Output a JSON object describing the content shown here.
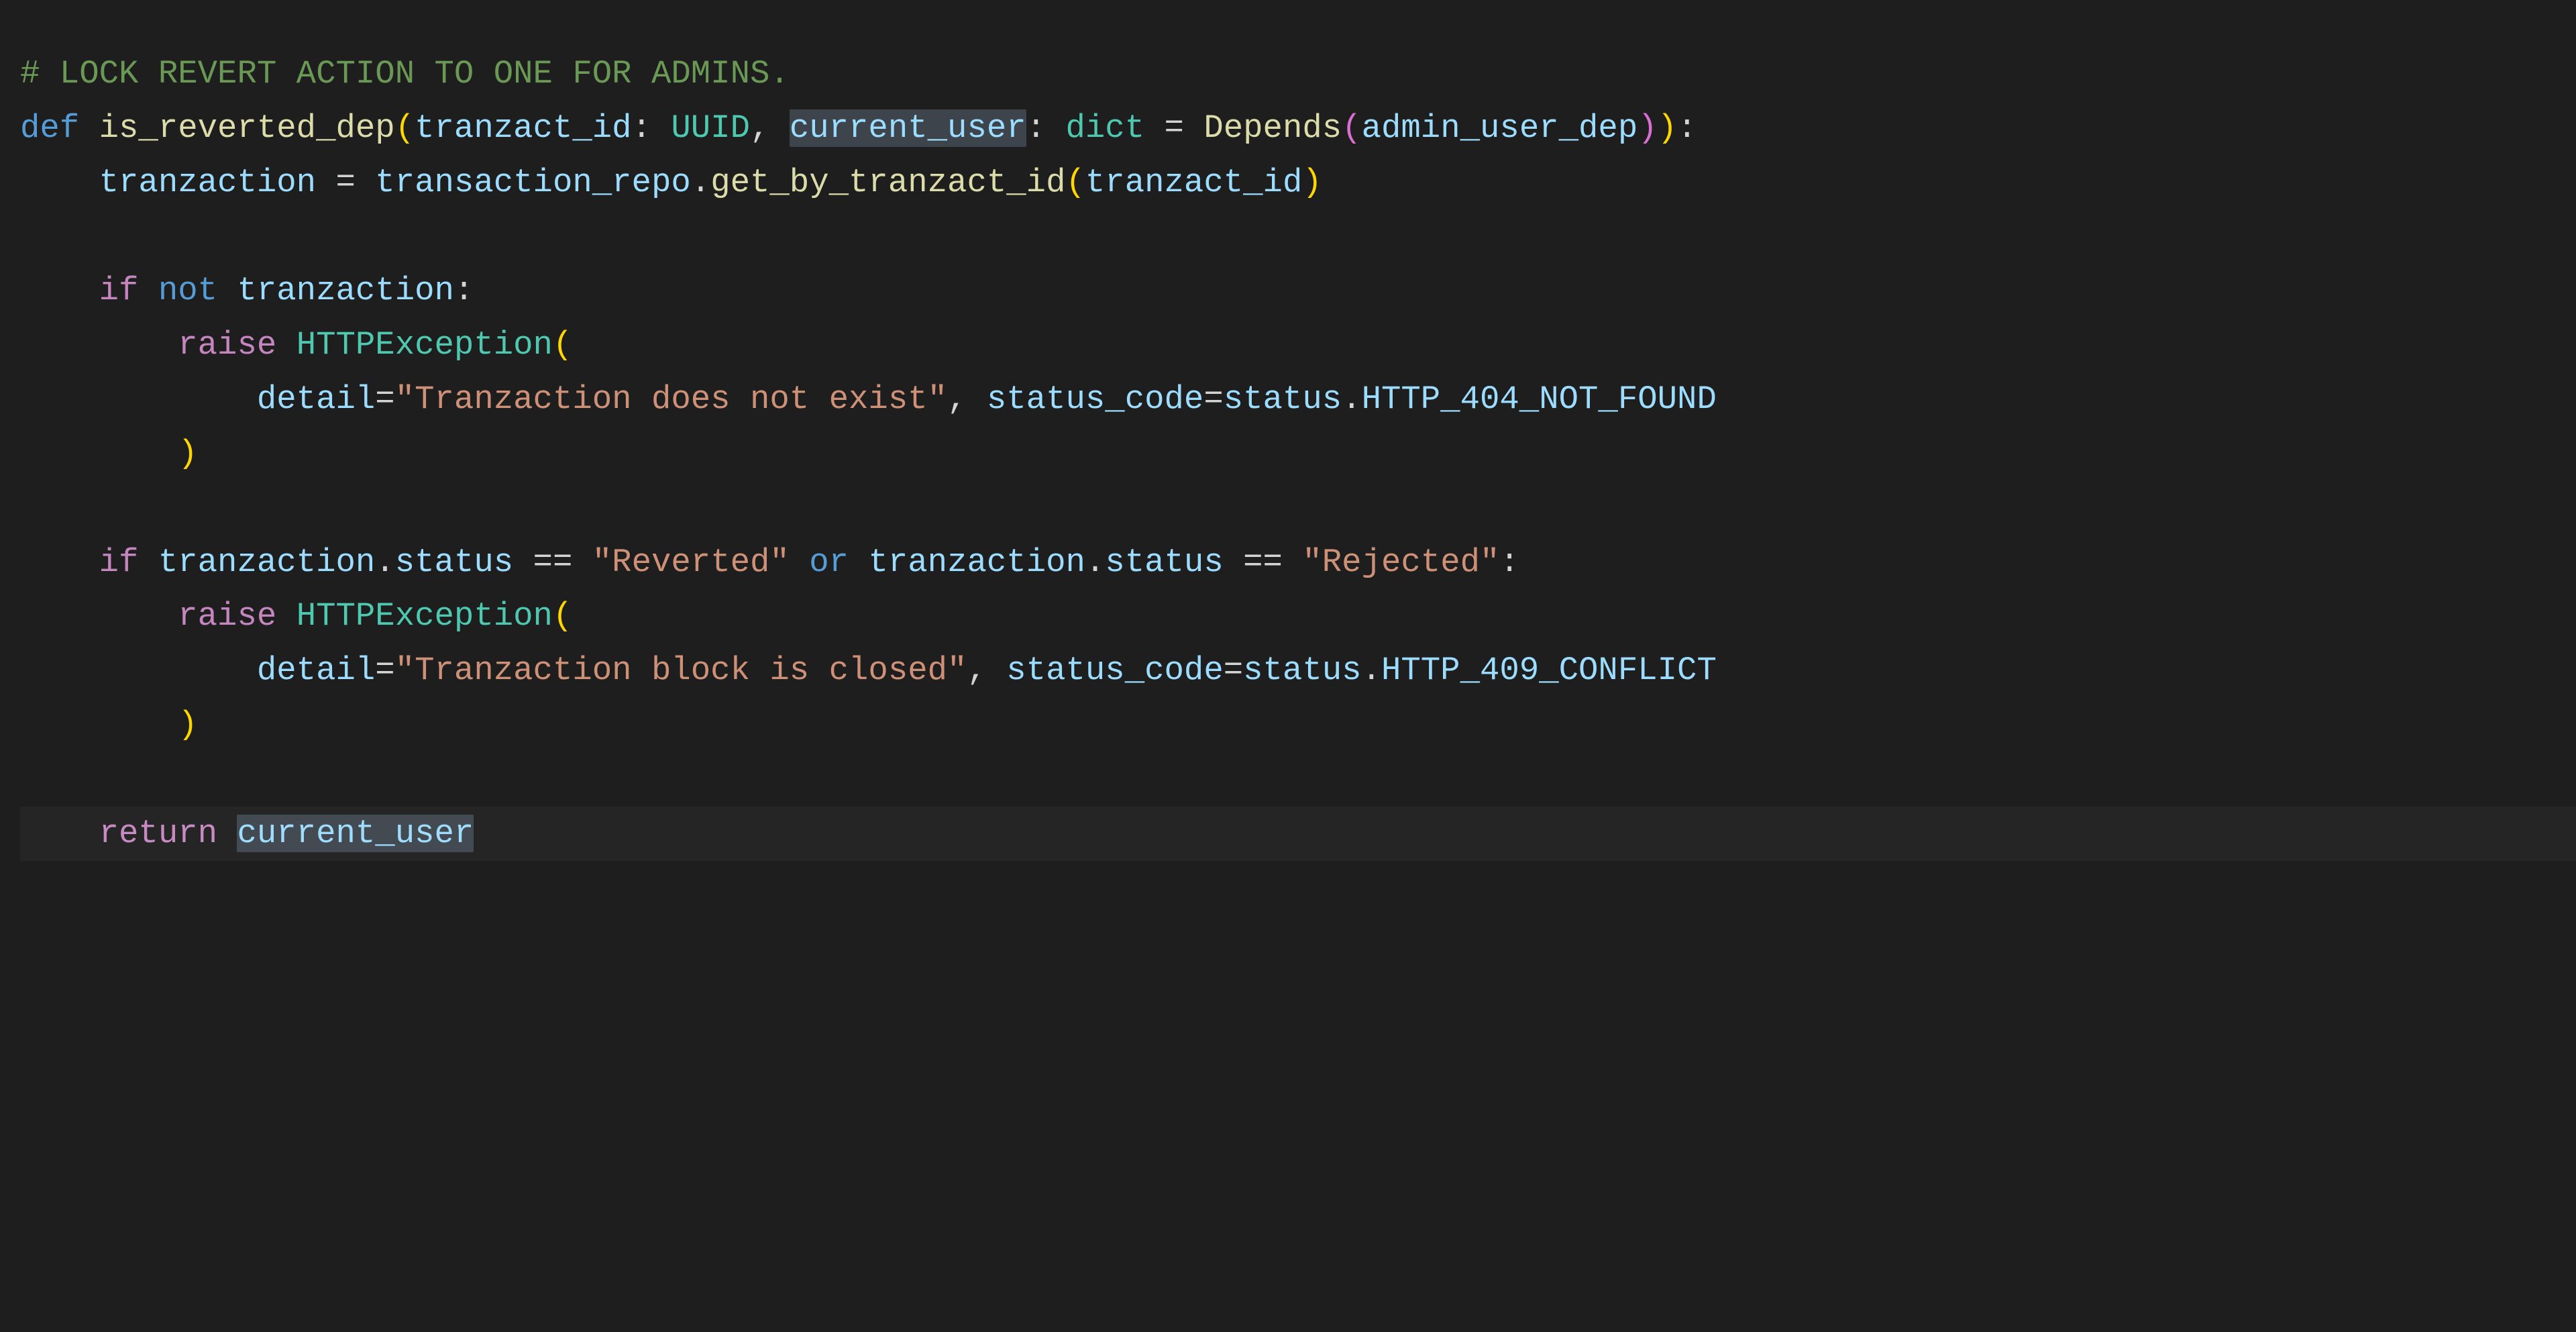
{
  "colors": {
    "background": "#1e1e1e",
    "comment": "#6a9955",
    "keyword": "#569cd6",
    "control": "#c586c0",
    "function": "#dcdcaa",
    "class": "#4ec9b0",
    "variable": "#9cdcfe",
    "string": "#ce9178",
    "default": "#d4d4d4",
    "bracket1": "#ffd700",
    "bracket2": "#da70d6",
    "selection": "rgba(120,140,160,0.35)"
  },
  "language": "python",
  "highlighted_word": "current_user",
  "current_line_index": 14,
  "code": {
    "lines": [
      {
        "indent": 0,
        "tokens": [
          {
            "t": "# LOCK REVERT ACTION TO ONE FOR ADMINS.",
            "c": "comment"
          }
        ]
      },
      {
        "indent": 0,
        "tokens": [
          {
            "t": "def ",
            "c": "keyword"
          },
          {
            "t": "is_reverted_dep",
            "c": "func"
          },
          {
            "t": "(",
            "c": "paren"
          },
          {
            "t": "tranzact_id",
            "c": "param"
          },
          {
            "t": ": ",
            "c": "punct"
          },
          {
            "t": "UUID",
            "c": "class"
          },
          {
            "t": ", ",
            "c": "punct"
          },
          {
            "t": "current_user",
            "c": "param",
            "sel": true
          },
          {
            "t": ": ",
            "c": "punct"
          },
          {
            "t": "dict",
            "c": "class"
          },
          {
            "t": " = ",
            "c": "op"
          },
          {
            "t": "Depends",
            "c": "func"
          },
          {
            "t": "(",
            "c": "paren2"
          },
          {
            "t": "admin_user_dep",
            "c": "var"
          },
          {
            "t": ")",
            "c": "paren2"
          },
          {
            "t": ")",
            "c": "paren"
          },
          {
            "t": ":",
            "c": "punct"
          }
        ]
      },
      {
        "indent": 1,
        "tokens": [
          {
            "t": "tranzaction",
            "c": "var"
          },
          {
            "t": " = ",
            "c": "op"
          },
          {
            "t": "transaction_repo",
            "c": "var"
          },
          {
            "t": ".",
            "c": "punct"
          },
          {
            "t": "get_by_tranzact_id",
            "c": "func"
          },
          {
            "t": "(",
            "c": "paren"
          },
          {
            "t": "tranzact_id",
            "c": "var"
          },
          {
            "t": ")",
            "c": "paren"
          }
        ]
      },
      {
        "indent": 0,
        "tokens": []
      },
      {
        "indent": 1,
        "tokens": [
          {
            "t": "if ",
            "c": "control"
          },
          {
            "t": "not ",
            "c": "keyword"
          },
          {
            "t": "tranzaction",
            "c": "var"
          },
          {
            "t": ":",
            "c": "punct"
          }
        ]
      },
      {
        "indent": 2,
        "tokens": [
          {
            "t": "raise ",
            "c": "control"
          },
          {
            "t": "HTTPException",
            "c": "class"
          },
          {
            "t": "(",
            "c": "paren"
          }
        ]
      },
      {
        "indent": 3,
        "tokens": [
          {
            "t": "detail",
            "c": "param"
          },
          {
            "t": "=",
            "c": "op"
          },
          {
            "t": "\"Tranzaction does not exist\"",
            "c": "string"
          },
          {
            "t": ", ",
            "c": "punct"
          },
          {
            "t": "status_code",
            "c": "param"
          },
          {
            "t": "=",
            "c": "op"
          },
          {
            "t": "status",
            "c": "var"
          },
          {
            "t": ".",
            "c": "punct"
          },
          {
            "t": "HTTP_404_NOT_FOUND",
            "c": "var"
          }
        ]
      },
      {
        "indent": 2,
        "tokens": [
          {
            "t": ")",
            "c": "paren"
          }
        ]
      },
      {
        "indent": 0,
        "tokens": []
      },
      {
        "indent": 1,
        "tokens": [
          {
            "t": "if ",
            "c": "control"
          },
          {
            "t": "tranzaction",
            "c": "var"
          },
          {
            "t": ".",
            "c": "punct"
          },
          {
            "t": "status",
            "c": "var"
          },
          {
            "t": " == ",
            "c": "op"
          },
          {
            "t": "\"Reverted\"",
            "c": "string"
          },
          {
            "t": " ",
            "c": "punct"
          },
          {
            "t": "or ",
            "c": "keyword"
          },
          {
            "t": "tranzaction",
            "c": "var"
          },
          {
            "t": ".",
            "c": "punct"
          },
          {
            "t": "status",
            "c": "var"
          },
          {
            "t": " == ",
            "c": "op"
          },
          {
            "t": "\"Rejected\"",
            "c": "string"
          },
          {
            "t": ":",
            "c": "punct"
          }
        ]
      },
      {
        "indent": 2,
        "tokens": [
          {
            "t": "raise ",
            "c": "control"
          },
          {
            "t": "HTTPException",
            "c": "class"
          },
          {
            "t": "(",
            "c": "paren"
          }
        ]
      },
      {
        "indent": 3,
        "tokens": [
          {
            "t": "detail",
            "c": "param"
          },
          {
            "t": "=",
            "c": "op"
          },
          {
            "t": "\"Tranzaction block is closed\"",
            "c": "string"
          },
          {
            "t": ", ",
            "c": "punct"
          },
          {
            "t": "status_code",
            "c": "param"
          },
          {
            "t": "=",
            "c": "op"
          },
          {
            "t": "status",
            "c": "var"
          },
          {
            "t": ".",
            "c": "punct"
          },
          {
            "t": "HTTP_409_CONFLICT",
            "c": "var"
          }
        ]
      },
      {
        "indent": 2,
        "tokens": [
          {
            "t": ")",
            "c": "paren"
          }
        ]
      },
      {
        "indent": 0,
        "tokens": []
      },
      {
        "indent": 1,
        "tokens": [
          {
            "t": "return ",
            "c": "control"
          },
          {
            "t": "current_user",
            "c": "var",
            "sel": true
          }
        ]
      }
    ]
  }
}
